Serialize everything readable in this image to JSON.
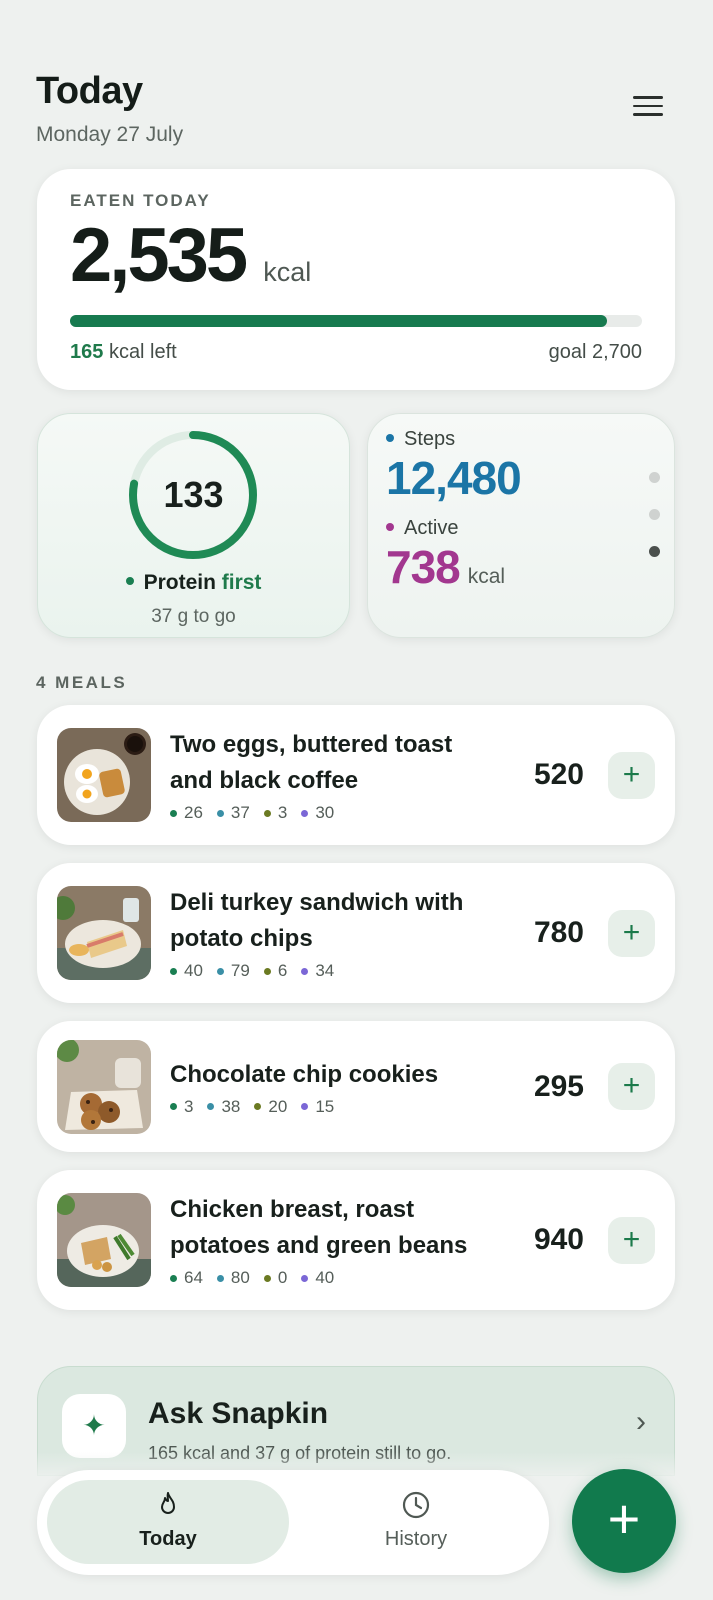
{
  "header": {
    "title": "Today",
    "date": "Monday 27 July"
  },
  "eaten": {
    "eyebrow": "EATEN TODAY",
    "value": "2,535",
    "unit": "kcal",
    "progress": 0.939,
    "left_value": "165",
    "left_text": "kcal left",
    "goal": "goal 2,700"
  },
  "protein": {
    "value": "133",
    "progress": 0.78,
    "label": "Protein",
    "label_highlight": "first",
    "sub": "37 g to go"
  },
  "activity": {
    "steps_label": "Steps",
    "steps_value": "12,480",
    "active_label": "Active",
    "active_value": "738",
    "active_unit": "kcal",
    "page_index": 3,
    "page_count": 3
  },
  "meals_section": {
    "label": "4 MEALS"
  },
  "meals": [
    {
      "name_line1": "Two eggs, buttered toast",
      "name_line2": "and black coffee",
      "kcal": "520",
      "macros": [
        "26",
        "37",
        "3",
        "30"
      ]
    },
    {
      "name_line1": "Deli turkey sandwich with",
      "name_line2": "potato chips",
      "kcal": "780",
      "macros": [
        "40",
        "79",
        "6",
        "34"
      ]
    },
    {
      "name_line1": "Chocolate chip cookies",
      "name_line2": "",
      "kcal": "295",
      "macros": [
        "3",
        "38",
        "20",
        "15"
      ]
    },
    {
      "name_line1": "Chicken breast, roast",
      "name_line2": "potatoes and green beans",
      "kcal": "940",
      "macros": [
        "64",
        "80",
        "0",
        "40"
      ]
    }
  ],
  "ask": {
    "title": "Ask Snapkin",
    "sub": "165 kcal and 37 g of protein still to go."
  },
  "tabs": {
    "today": "Today",
    "history": "History"
  },
  "fab": {
    "label": "+"
  },
  "colors": {
    "accent_green": "#117a4d",
    "steps_blue": "#1b75a6",
    "active_purple": "#a2378f",
    "macro_protein": "#1a7f52",
    "macro_carbs": "#3a8fa6",
    "macro_fat": "#6b7a22",
    "macro_other": "#7b67d6"
  }
}
